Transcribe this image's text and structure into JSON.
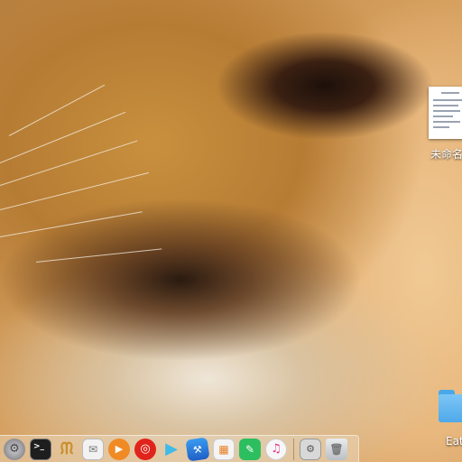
{
  "desktop": {
    "wallpaper": "lion-close-up",
    "icons": [
      {
        "id": "document",
        "label": "未命名",
        "type": "document-icon"
      },
      {
        "id": "folder",
        "label": "Eat",
        "type": "folder-icon"
      }
    ]
  },
  "dock": {
    "apps": [
      {
        "name": "System Preferences",
        "icon": "gear-icon",
        "color": "#8e8e93"
      },
      {
        "name": "Terminal",
        "icon": "terminal-icon",
        "color": "#1e1e1e"
      },
      {
        "name": "Gradle",
        "icon": "elephant-icon",
        "color": "#c9902e"
      },
      {
        "name": "Finder Mail",
        "icon": "mail-icon",
        "color": "#f2f2f2"
      },
      {
        "name": "Infuse",
        "icon": "play-circle-icon",
        "color": "#f08a24"
      },
      {
        "name": "NetEase Music",
        "icon": "music-note-icon",
        "color": "#e0241b"
      },
      {
        "name": "Video Player",
        "icon": "play-icon",
        "color": "#3fbbe8"
      },
      {
        "name": "Xcode",
        "icon": "hammer-icon",
        "color": "#1f7ed6"
      },
      {
        "name": "Preview",
        "icon": "photos-icon",
        "color": "#f4f4f4"
      },
      {
        "name": "Evernote",
        "icon": "elephant-note-icon",
        "color": "#2dbe60"
      },
      {
        "name": "iTunes",
        "icon": "note-icon",
        "color": "#f7f7f7"
      }
    ],
    "extras": [
      {
        "name": "Downloads Stack",
        "icon": "stack-icon",
        "color": "#d8d8d8"
      },
      {
        "name": "Trash",
        "icon": "trash-icon",
        "color": "#cfd3d6"
      }
    ],
    "prompt_symbol": ">_",
    "terminal_glyph": "▶"
  }
}
